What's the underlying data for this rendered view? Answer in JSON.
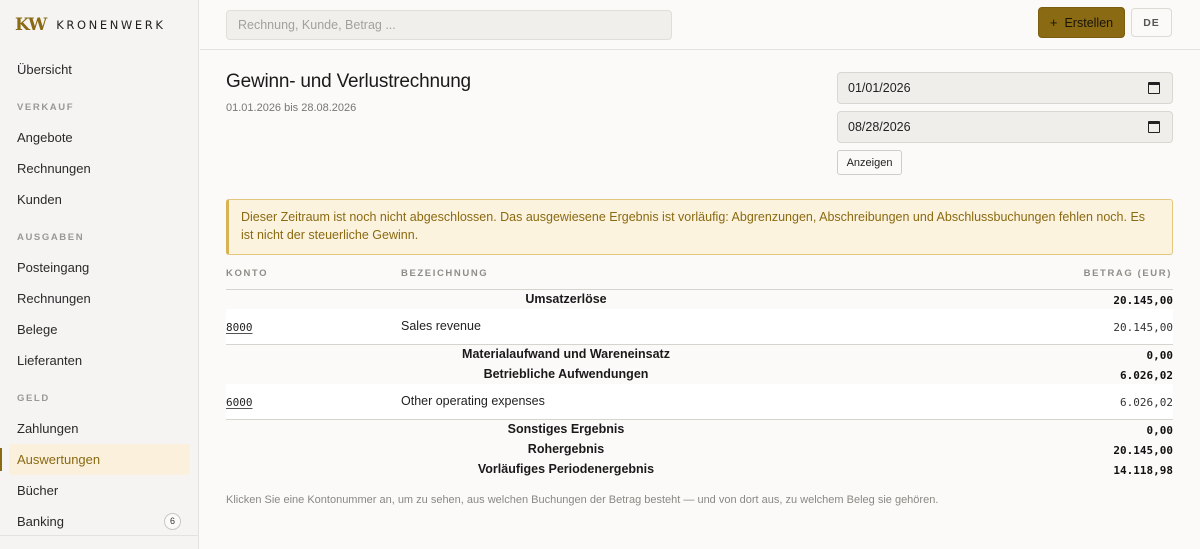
{
  "brand": {
    "mark": "KW",
    "name": "KRONENWERK"
  },
  "sidebar": {
    "items": [
      {
        "type": "item",
        "label": "Übersicht",
        "name": "sidebar-item-uebersicht"
      },
      {
        "type": "section",
        "label": "VERKAUF",
        "name": "sidebar-section-verkauf"
      },
      {
        "type": "item",
        "label": "Angebote",
        "name": "sidebar-item-angebote"
      },
      {
        "type": "item",
        "label": "Rechnungen",
        "name": "sidebar-item-rechnungen-verkauf"
      },
      {
        "type": "item",
        "label": "Kunden",
        "name": "sidebar-item-kunden"
      },
      {
        "type": "section",
        "label": "AUSGABEN",
        "name": "sidebar-section-ausgaben"
      },
      {
        "type": "item",
        "label": "Posteingang",
        "name": "sidebar-item-posteingang"
      },
      {
        "type": "item",
        "label": "Rechnungen",
        "name": "sidebar-item-rechnungen-ausgaben"
      },
      {
        "type": "item",
        "label": "Belege",
        "name": "sidebar-item-belege"
      },
      {
        "type": "item",
        "label": "Lieferanten",
        "name": "sidebar-item-lieferanten"
      },
      {
        "type": "section",
        "label": "GELD",
        "name": "sidebar-section-geld"
      },
      {
        "type": "item",
        "label": "Zahlungen",
        "name": "sidebar-item-zahlungen"
      },
      {
        "type": "item",
        "label": "Auswertungen",
        "name": "sidebar-item-auswertungen",
        "active": true
      },
      {
        "type": "item",
        "label": "Bücher",
        "name": "sidebar-item-buecher"
      },
      {
        "type": "item",
        "label": "Banking",
        "name": "sidebar-item-banking",
        "badge": "6"
      }
    ]
  },
  "header": {
    "search_placeholder": "Rechnung, Kunde, Betrag ...",
    "create_icon": "+",
    "create_label": "Erstellen",
    "lang_label": "DE"
  },
  "report": {
    "title": "Gewinn- und Verlustrechnung",
    "period": "01.01.2026 bis 28.08.2026",
    "date_from": "01/01/2026",
    "date_to": "08/28/2026",
    "show_button": "Anzeigen",
    "warning": "Dieser Zeitraum ist noch nicht abgeschlossen. Das ausgewiesene Ergebnis ist vorläufig: Abgrenzungen, Abschreibungen und Abschlussbuchungen fehlen noch. Es ist nicht der steuerliche Gewinn.",
    "columns": {
      "konto": "KONTO",
      "bezeichnung": "BEZEICHNUNG",
      "betrag": "BETRAG (EUR)"
    },
    "groups": {
      "umsatz": {
        "label": "Umsatzerlöse",
        "amount": "20.145,00"
      },
      "material": {
        "label": "Materialaufwand und Wareneinsatz",
        "amount": "0,00"
      },
      "betrieblich": {
        "label": "Betriebliche Aufwendungen",
        "amount": "6.026,02"
      },
      "sonstiges": {
        "label": "Sonstiges Ergebnis",
        "amount": "0,00"
      },
      "rohergebnis": {
        "label": "Rohergebnis",
        "amount": "20.145,00"
      },
      "periode": {
        "label": "Vorläufiges Periodenergebnis",
        "amount": "14.118,98"
      }
    },
    "accounts": {
      "a8000": {
        "number": "8000",
        "name": "Sales revenue",
        "amount": "20.145,00"
      },
      "a6000": {
        "number": "6000",
        "name": "Other operating expenses",
        "amount": "6.026,02"
      }
    },
    "footnote": "Klicken Sie eine Kontonummer an, um zu sehen, aus welchen Buchungen der Betrag besteht — und von dort aus, zu welchem Beleg sie gehören."
  },
  "colors": {
    "accent": "#8a6a12",
    "warning_bg": "#fcf3de",
    "warning_border": "#e3c77e",
    "active_bg": "#fbf0dc"
  }
}
